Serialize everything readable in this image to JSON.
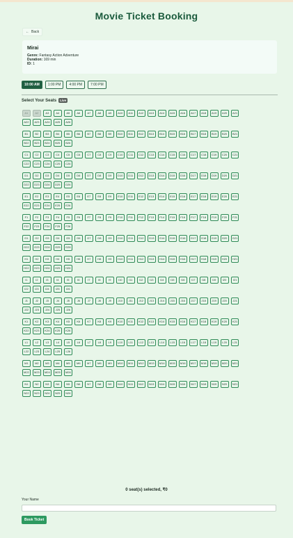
{
  "page": {
    "title": "Movie Ticket Booking",
    "back_label": "Back",
    "back_icon": "←"
  },
  "movie": {
    "title": "Mirai",
    "genre_label": "Genre:",
    "genre": "Fantasy Action Adventure",
    "duration_label": "Duration:",
    "duration": "169 min",
    "id_label": "ID:",
    "id": "1"
  },
  "showtimes": [
    "10:00 AM",
    "1:00 PM",
    "4:00 PM",
    "7:00 PM"
  ],
  "selected_showtime": 0,
  "seats": {
    "heading": "Select Your Seats",
    "badge": "Live",
    "rows": [
      "A",
      "B",
      "C",
      "D",
      "E",
      "F",
      "G",
      "H",
      "I",
      "J",
      "K",
      "L",
      "M",
      "N"
    ],
    "per_row": 26,
    "booked": [
      "A1",
      "A2"
    ]
  },
  "summary": "0 seat(s) selected, ₹0",
  "form": {
    "name_label": "Your Name",
    "name_value": "",
    "name_placeholder": "",
    "book_label": "Book Ticket"
  },
  "colors": {
    "background": "#e8f6e9",
    "title": "#1a5a3c",
    "seat_border": "#2e8a56",
    "active_time": "#1e5e40",
    "book_button": "#2d9a60",
    "booked_seat": "#c9d6cc"
  }
}
